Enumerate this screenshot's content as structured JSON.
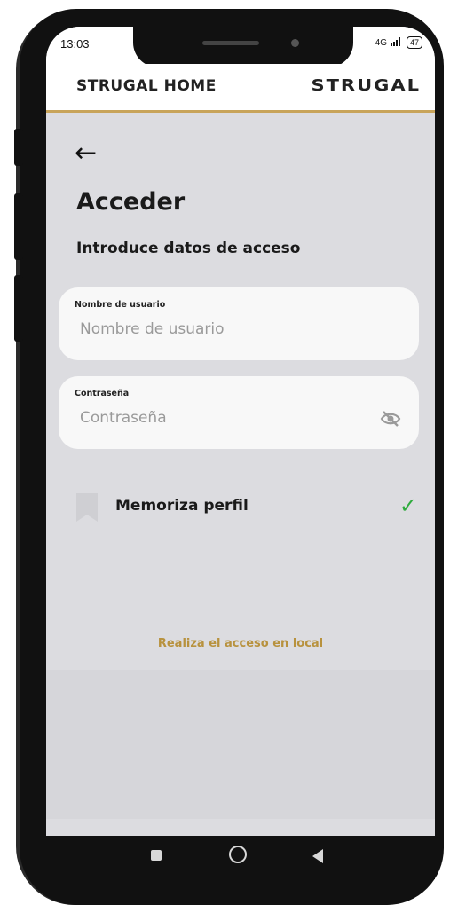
{
  "status": {
    "time": "13:03",
    "network": "4G",
    "battery": "47"
  },
  "header": {
    "title": "STRUGAL HOME",
    "brand": "STRUGAL"
  },
  "page": {
    "back_icon": "arrow-left-icon",
    "heading": "Acceder",
    "subtitle": "Introduce datos de acceso"
  },
  "form": {
    "username": {
      "label": "Nombre de usuario",
      "placeholder": "Nombre de usuario",
      "value": ""
    },
    "password": {
      "label": "Contraseña",
      "placeholder": "Contraseña",
      "value": "",
      "toggle_icon": "eye-off-icon"
    },
    "remember": {
      "label": "Memoriza perfil",
      "checked": true
    }
  },
  "local_access_link": "Realiza el acceso en local",
  "colors": {
    "accent": "#c8a45a",
    "link": "#b8923e",
    "check": "#2eab3d",
    "background": "#dcdce0"
  }
}
